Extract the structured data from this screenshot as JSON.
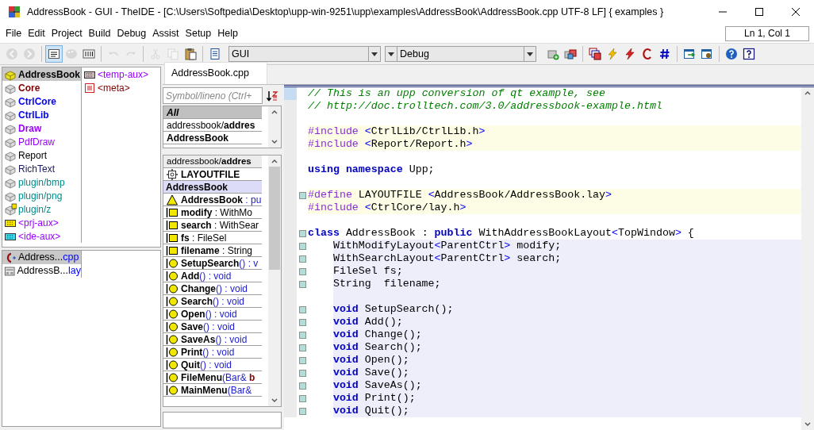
{
  "window": {
    "title": "AddressBook - GUI - TheIDE - [C:\\Users\\Softpedia\\Desktop\\upp-win-9251\\upp\\examples\\AddressBook\\AddressBook.cpp UTF-8 LF] { examples }"
  },
  "menu": [
    "File",
    "Edit",
    "Project",
    "Build",
    "Debug",
    "Assist",
    "Setup",
    "Help"
  ],
  "status": {
    "position": "Ln 1, Col 1"
  },
  "toolbar": {
    "left": [
      {
        "kind": "back",
        "disabled": true,
        "pressed": false
      },
      {
        "kind": "forward",
        "disabled": true,
        "pressed": false
      },
      {
        "kind": "sep"
      },
      {
        "kind": "text-mode",
        "disabled": false,
        "pressed": true
      },
      {
        "kind": "palette",
        "disabled": true,
        "pressed": false
      },
      {
        "kind": "binary",
        "disabled": false,
        "pressed": false
      },
      {
        "kind": "sep"
      },
      {
        "kind": "undo",
        "disabled": true,
        "pressed": false
      },
      {
        "kind": "redo",
        "disabled": true,
        "pressed": false
      },
      {
        "kind": "sep"
      },
      {
        "kind": "cut",
        "disabled": true,
        "pressed": false
      },
      {
        "kind": "copy",
        "disabled": true,
        "pressed": false
      },
      {
        "kind": "paste",
        "disabled": false,
        "pressed": false
      },
      {
        "kind": "sep"
      },
      {
        "kind": "document",
        "disabled": false,
        "pressed": false
      }
    ],
    "config": "GUI",
    "mode": "Debug",
    "right": [
      {
        "kind": "package-add",
        "disabled": false,
        "pressed": false
      },
      {
        "kind": "packages",
        "disabled": false,
        "pressed": false
      },
      {
        "kind": "sep"
      },
      {
        "kind": "windows",
        "disabled": false,
        "pressed": false
      },
      {
        "kind": "bolt",
        "disabled": false,
        "pressed": false
      },
      {
        "kind": "bolt-red",
        "disabled": false,
        "pressed": false
      },
      {
        "kind": "c-curve",
        "disabled": false,
        "pressed": false
      },
      {
        "kind": "hash",
        "disabled": false,
        "pressed": false
      },
      {
        "kind": "sep"
      },
      {
        "kind": "export",
        "disabled": false,
        "pressed": false
      },
      {
        "kind": "flash-window",
        "disabled": false,
        "pressed": false
      },
      {
        "kind": "sep"
      },
      {
        "kind": "help",
        "disabled": false,
        "pressed": false
      },
      {
        "kind": "help-box",
        "disabled": false,
        "pressed": false
      }
    ]
  },
  "packages": [
    {
      "name": "AddressBook",
      "kind": "package-main",
      "bold": true,
      "color": "#000000",
      "selected": true
    },
    {
      "name": "Core",
      "kind": "package",
      "bold": true,
      "color": "#800000",
      "selected": false
    },
    {
      "name": "CtrlCore",
      "kind": "package",
      "bold": true,
      "color": "#0000ff",
      "selected": false
    },
    {
      "name": "CtrlLib",
      "kind": "package",
      "bold": true,
      "color": "#0000ff",
      "selected": false
    },
    {
      "name": "Draw",
      "kind": "package",
      "bold": true,
      "color": "#9900ff",
      "selected": false
    },
    {
      "name": "PdfDraw",
      "kind": "package",
      "bold": false,
      "color": "#9900ff",
      "selected": false
    },
    {
      "name": "Report",
      "kind": "package",
      "bold": false,
      "color": "#000000",
      "selected": false
    },
    {
      "name": "RichText",
      "kind": "package",
      "bold": false,
      "color": "#202060",
      "selected": false
    },
    {
      "name": "plugin/bmp",
      "kind": "package",
      "bold": false,
      "color": "#008b8b",
      "selected": false
    },
    {
      "name": "plugin/png",
      "kind": "package",
      "bold": false,
      "color": "#008b8b",
      "selected": false
    },
    {
      "name": "plugin/z",
      "kind": "package-flag",
      "bold": false,
      "color": "#008b8b",
      "selected": false
    },
    {
      "name": "<prj-aux>",
      "kind": "prj-aux",
      "bold": false,
      "color": "#9900ff",
      "selected": false
    },
    {
      "name": "<ide-aux>",
      "kind": "ide-aux",
      "bold": false,
      "color": "#9900ff",
      "selected": false
    },
    {
      "name": "<temp-aux>",
      "kind": "temp-aux",
      "bold": false,
      "color": "#9900ff",
      "selected": false
    },
    {
      "name": "<meta>",
      "kind": "meta",
      "bold": false,
      "color": "#800000",
      "selected": false
    }
  ],
  "files": [
    {
      "name": "Address...",
      "ext": "cpp",
      "kind": "cpp",
      "selected": true
    },
    {
      "name": "AddressB...",
      "ext": "lay",
      "kind": "lay",
      "selected": false
    }
  ],
  "tabs": [
    {
      "label": "AddressBook.cpp",
      "selected": true
    }
  ],
  "navigator": {
    "search": {
      "placeholder": "Symbol/lineno (Ctrl+"
    },
    "scopes": [
      {
        "label": "All",
        "selected": true
      },
      {
        "label": "addressbook/**addres**",
        "selected": false
      },
      {
        "label": "**AddressBook**",
        "selected": false
      }
    ],
    "items": [
      {
        "kind": "file",
        "name": "addressbook/**addres**",
        "selected": false
      },
      {
        "kind": "macro",
        "name": "LAYOUTFILE",
        "selected": false
      },
      {
        "kind": "scope",
        "name": "AddressBook",
        "selected": true
      },
      {
        "kind": "class",
        "name": "AddressBook",
        "detail": " : pu",
        "selected": false
      },
      {
        "kind": "variable",
        "name": "modify",
        "detail": " : WithMo",
        "selected": false
      },
      {
        "kind": "variable",
        "name": "search",
        "detail": " : WithSear",
        "selected": false
      },
      {
        "kind": "variable",
        "name": "fs",
        "detail": " : FileSel",
        "selected": false
      },
      {
        "kind": "variable",
        "name": "filename",
        "detail": " : String",
        "selected": false
      },
      {
        "kind": "function",
        "name": "SetupSearch",
        "detail": "() : v",
        "selected": false
      },
      {
        "kind": "function",
        "name": "Add",
        "detail": "() : void",
        "selected": false
      },
      {
        "kind": "function",
        "name": "Change",
        "detail": "() : void",
        "selected": false
      },
      {
        "kind": "function",
        "name": "Search",
        "detail": "() : void",
        "selected": false
      },
      {
        "kind": "function",
        "name": "Open",
        "detail": "() : void",
        "selected": false
      },
      {
        "kind": "function",
        "name": "Save",
        "detail": "() : void",
        "selected": false
      },
      {
        "kind": "function",
        "name": "SaveAs",
        "detail": "() : void",
        "selected": false
      },
      {
        "kind": "function",
        "name": "Print",
        "detail": "() : void",
        "selected": false
      },
      {
        "kind": "function",
        "name": "Quit",
        "detail": "() : void",
        "selected": false
      },
      {
        "kind": "function",
        "name": "FileMenu",
        "detail": "(Bar& **b**",
        "selected": false
      },
      {
        "kind": "function",
        "name": "MainMenu",
        "detail": "(Bar&",
        "selected": false
      }
    ]
  },
  "code": [
    {
      "kind": "plain",
      "marker": false,
      "current": true,
      "tokens": [
        {
          "kind": "comment",
          "text": "// This is an upp conversion of qt example, see"
        }
      ]
    },
    {
      "kind": "plain",
      "marker": false,
      "current": false,
      "tokens": [
        {
          "kind": "comment",
          "text": "// http://doc.trolltech.com/3.0/addressbook-example.html"
        }
      ]
    },
    {
      "kind": "plain",
      "marker": false,
      "current": false
    },
    {
      "kind": "preprocessor",
      "marker": false,
      "current": false,
      "tokens": [
        {
          "kind": "directive",
          "text": "#include"
        },
        {
          "kind": "bracket",
          "text": " <"
        },
        {
          "kind": "text",
          "text": "CtrlLib/CtrlLib.h"
        },
        {
          "kind": "bracket",
          "text": ">"
        }
      ]
    },
    {
      "kind": "preprocessor",
      "marker": false,
      "current": false,
      "tokens": [
        {
          "kind": "directive",
          "text": "#include"
        },
        {
          "kind": "bracket",
          "text": " <"
        },
        {
          "kind": "text",
          "text": "Report/Report.h"
        },
        {
          "kind": "bracket",
          "text": ">"
        }
      ]
    },
    {
      "kind": "plain",
      "marker": false,
      "current": false
    },
    {
      "kind": "plain",
      "marker": false,
      "current": false,
      "tokens": [
        {
          "kind": "keyword",
          "text": "using namespace"
        },
        {
          "kind": "text",
          "text": " Upp;"
        }
      ]
    },
    {
      "kind": "plain",
      "marker": false,
      "current": false
    },
    {
      "kind": "preprocessor",
      "marker": true,
      "current": false,
      "tokens": [
        {
          "kind": "directive",
          "text": "#define"
        },
        {
          "kind": "text",
          "text": " LAYOUTFILE "
        },
        {
          "kind": "bracket",
          "text": "<"
        },
        {
          "kind": "text",
          "text": "AddressBook/AddressBook.lay"
        },
        {
          "kind": "bracket",
          "text": ">"
        }
      ]
    },
    {
      "kind": "preprocessor",
      "marker": false,
      "current": false,
      "tokens": [
        {
          "kind": "directive",
          "text": "#include"
        },
        {
          "kind": "bracket",
          "text": " <"
        },
        {
          "kind": "text",
          "text": "CtrlCore/lay.h"
        },
        {
          "kind": "bracket",
          "text": ">"
        }
      ]
    },
    {
      "kind": "plain",
      "marker": false,
      "current": false
    },
    {
      "kind": "plain",
      "marker": true,
      "current": false,
      "tokens": [
        {
          "kind": "keyword",
          "text": "class"
        },
        {
          "kind": "text",
          "text": " AddressBook : "
        },
        {
          "kind": "keyword",
          "text": "public"
        },
        {
          "kind": "text",
          "text": " WithAddressBookLayout"
        },
        {
          "kind": "bracket",
          "text": "<"
        },
        {
          "kind": "text",
          "text": "TopWindow"
        },
        {
          "kind": "bracket",
          "text": ">"
        },
        {
          "kind": "text",
          "text": " {"
        }
      ]
    },
    {
      "kind": "class",
      "marker": true,
      "current": false,
      "tokens": [
        {
          "kind": "text",
          "text": "WithModifyLayout"
        },
        {
          "kind": "bracket",
          "text": "<"
        },
        {
          "kind": "text",
          "text": "ParentCtrl"
        },
        {
          "kind": "bracket",
          "text": ">"
        },
        {
          "kind": "text",
          "text": " modify;"
        }
      ]
    },
    {
      "kind": "class",
      "marker": true,
      "current": false,
      "tokens": [
        {
          "kind": "text",
          "text": "WithSearchLayout"
        },
        {
          "kind": "bracket",
          "text": "<"
        },
        {
          "kind": "text",
          "text": "ParentCtrl"
        },
        {
          "kind": "bracket",
          "text": ">"
        },
        {
          "kind": "text",
          "text": " search;"
        }
      ]
    },
    {
      "kind": "class",
      "marker": true,
      "current": false,
      "tokens": [
        {
          "kind": "text",
          "text": "FileSel fs;"
        }
      ]
    },
    {
      "kind": "class",
      "marker": true,
      "current": false,
      "tokens": [
        {
          "kind": "text",
          "text": "String  filename;"
        }
      ]
    },
    {
      "kind": "class",
      "marker": false,
      "current": false
    },
    {
      "kind": "class",
      "marker": true,
      "current": false,
      "tokens": [
        {
          "kind": "keyword",
          "text": "void"
        },
        {
          "kind": "text",
          "text": " SetupSearch();"
        }
      ]
    },
    {
      "kind": "class",
      "marker": true,
      "current": false,
      "tokens": [
        {
          "kind": "keyword",
          "text": "void"
        },
        {
          "kind": "text",
          "text": " Add();"
        }
      ]
    },
    {
      "kind": "class",
      "marker": true,
      "current": false,
      "tokens": [
        {
          "kind": "keyword",
          "text": "void"
        },
        {
          "kind": "text",
          "text": " Change();"
        }
      ]
    },
    {
      "kind": "class",
      "marker": true,
      "current": false,
      "tokens": [
        {
          "kind": "keyword",
          "text": "void"
        },
        {
          "kind": "text",
          "text": " Search();"
        }
      ]
    },
    {
      "kind": "class",
      "marker": true,
      "current": false,
      "tokens": [
        {
          "kind": "keyword",
          "text": "void"
        },
        {
          "kind": "text",
          "text": " Open();"
        }
      ]
    },
    {
      "kind": "class",
      "marker": true,
      "current": false,
      "tokens": [
        {
          "kind": "keyword",
          "text": "void"
        },
        {
          "kind": "text",
          "text": " Save();"
        }
      ]
    },
    {
      "kind": "class",
      "marker": true,
      "current": false,
      "tokens": [
        {
          "kind": "keyword",
          "text": "void"
        },
        {
          "kind": "text",
          "text": " SaveAs();"
        }
      ]
    },
    {
      "kind": "class",
      "marker": true,
      "current": false,
      "tokens": [
        {
          "kind": "keyword",
          "text": "void"
        },
        {
          "kind": "text",
          "text": " Print();"
        }
      ]
    },
    {
      "kind": "class",
      "marker": true,
      "current": false,
      "tokens": [
        {
          "kind": "keyword",
          "text": "void"
        },
        {
          "kind": "text",
          "text": " Quit();"
        }
      ]
    }
  ]
}
